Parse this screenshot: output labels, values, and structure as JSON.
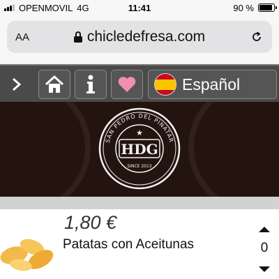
{
  "status_bar": {
    "carrier": "OPENMOVIL",
    "network": "4G",
    "time": "11:41",
    "battery_percent": "90 %",
    "battery_level": 0.9
  },
  "browser": {
    "text_size_label": "AA",
    "url": "chicledefresa.com",
    "icons": [
      "lock-icon",
      "reload-icon"
    ]
  },
  "nav": {
    "icons": [
      "chevron-right-icon",
      "home-icon",
      "info-icon",
      "heart-icon",
      "spain-flag-icon"
    ],
    "language_label": "Español",
    "colors": {
      "bar": "#4a4a4a",
      "heart": "#f08fb2"
    }
  },
  "banner": {
    "logo_text": "HDG",
    "logo_ring_text": "SAN PEDRO DEL PINATAR",
    "logo_since": "SINCE 2013",
    "background": "#24140f"
  },
  "product": {
    "price": "1,80 €",
    "name": "Patatas con Aceitunas",
    "quantity": "0",
    "icons": [
      "potato-chips-image",
      "increment-icon",
      "decrement-icon"
    ]
  }
}
